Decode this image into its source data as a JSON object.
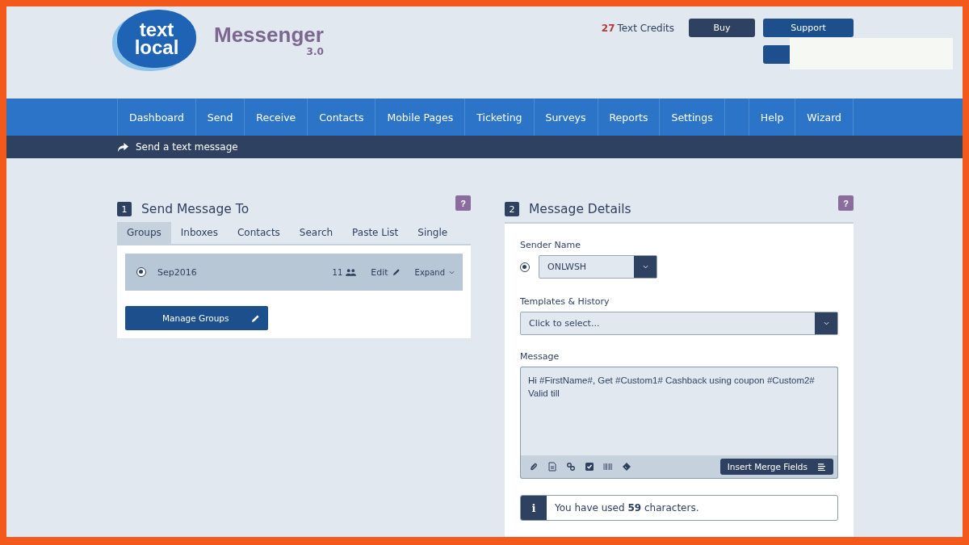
{
  "logo": {
    "line1": "text",
    "line2": "local"
  },
  "app": {
    "title": "Messenger",
    "version": "3.0"
  },
  "credits": {
    "count": "27",
    "label": "Text Credits"
  },
  "header_buttons": [
    {
      "label": "Buy",
      "kind": "dark"
    },
    {
      "label": "Support",
      "kind": "blue"
    },
    {
      "kind": "blank"
    }
  ],
  "nav": {
    "items": [
      "Dashboard",
      "Send",
      "Receive",
      "Contacts",
      "Mobile Pages",
      "Ticketing",
      "Surveys",
      "Reports",
      "Settings"
    ],
    "right_items": [
      "Help",
      "Wizard"
    ]
  },
  "breadcrumb": "Send a text message",
  "send_to": {
    "number": "1",
    "title": "Send Message To",
    "help": "?",
    "tabs": [
      {
        "label": "Groups",
        "selected": true
      },
      {
        "label": "Inboxes",
        "selected": false
      },
      {
        "label": "Contacts",
        "selected": false
      },
      {
        "label": "Search",
        "selected": false
      },
      {
        "label": "Paste List",
        "selected": false
      },
      {
        "label": "Single",
        "selected": false
      }
    ],
    "groups": [
      {
        "name": "Sep2016",
        "selected": true,
        "count": "11",
        "edit": "Edit",
        "expand": "Expand"
      }
    ],
    "manage_button": "Manage Groups"
  },
  "details": {
    "number": "2",
    "title": "Message Details",
    "help": "?",
    "sender_label": "Sender Name",
    "sender_selected": true,
    "sender_value": "ONLWSH",
    "templates_label": "Templates & History",
    "templates_placeholder": "Click to select...",
    "message_label": "Message",
    "message_value": "Hi #FirstName#, Get #Custom1# Cashback using coupon #Custom2# Valid till",
    "merge_button": "Insert Merge Fields",
    "info_icon": "i",
    "info_text": "You have used **59** characters."
  }
}
